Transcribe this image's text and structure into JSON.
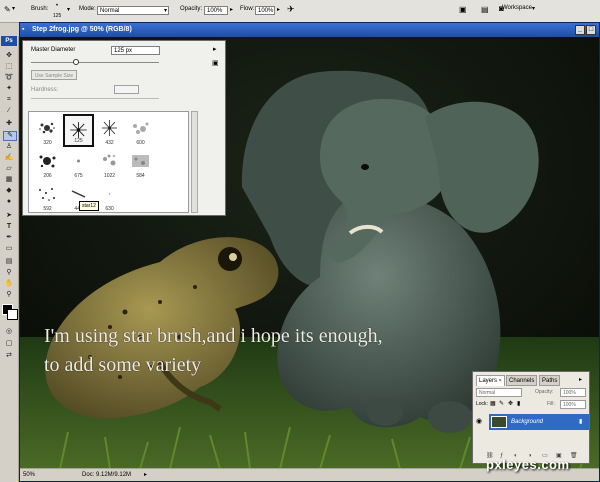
{
  "options_bar": {
    "brush_label": "Brush:",
    "brush_size": "125",
    "mode_label": "Mode:",
    "mode_value": "Normal",
    "opacity_label": "Opacity:",
    "opacity_value": "100%",
    "flow_label": "Flow:",
    "flow_value": "100%",
    "workspace_label": "Workspace"
  },
  "toolbox": {
    "logo": "Ps"
  },
  "document": {
    "title": "Step 2frog.jpg @ 50% (RGB/8)",
    "zoom": "50%",
    "doc_info": "Doc: 9.12M/9.12M"
  },
  "brushes_panel": {
    "master_diameter_label": "Master Diameter",
    "master_diameter_value": "125 px",
    "master_diameter_fraction": 0.35,
    "use_sample_size": "Use Sample Size",
    "hardness_label": "Hardness:",
    "presets": [
      {
        "size": "320",
        "icon": "splatter-brush"
      },
      {
        "size": "125",
        "icon": "star-brush",
        "selected": true
      },
      {
        "size": "432",
        "icon": "star-brush"
      },
      {
        "size": "600",
        "icon": "texture-brush"
      },
      {
        "size": "206",
        "icon": "splatter-brush"
      },
      {
        "size": "675",
        "icon": "soft-brush"
      },
      {
        "size": "1022",
        "icon": "texture-brush"
      },
      {
        "size": "584",
        "icon": "texture-brush"
      },
      {
        "size": "592",
        "icon": "dots-brush"
      },
      {
        "size": "446",
        "icon": "streak-brush"
      },
      {
        "size": "630",
        "icon": "soft-brush"
      }
    ],
    "tooltip": "star12"
  },
  "canvas_text": {
    "line1": "I'm using star brush,and i hope its enough,",
    "line2": "to add some variety"
  },
  "layers_panel": {
    "tabs": [
      "Layers",
      "Channels",
      "Paths"
    ],
    "blend_mode": "Normal",
    "opacity_label": "Opacity:",
    "opacity_value": "100%",
    "lock_label": "Lock:",
    "fill_label": "Fill:",
    "fill_value": "100%",
    "layer_name": "Background"
  },
  "watermark": "pxleyes.com",
  "colors": {
    "title_bar": "#1f4ea0",
    "selection": "#316ac5",
    "tooltip": "#ffffe1"
  }
}
